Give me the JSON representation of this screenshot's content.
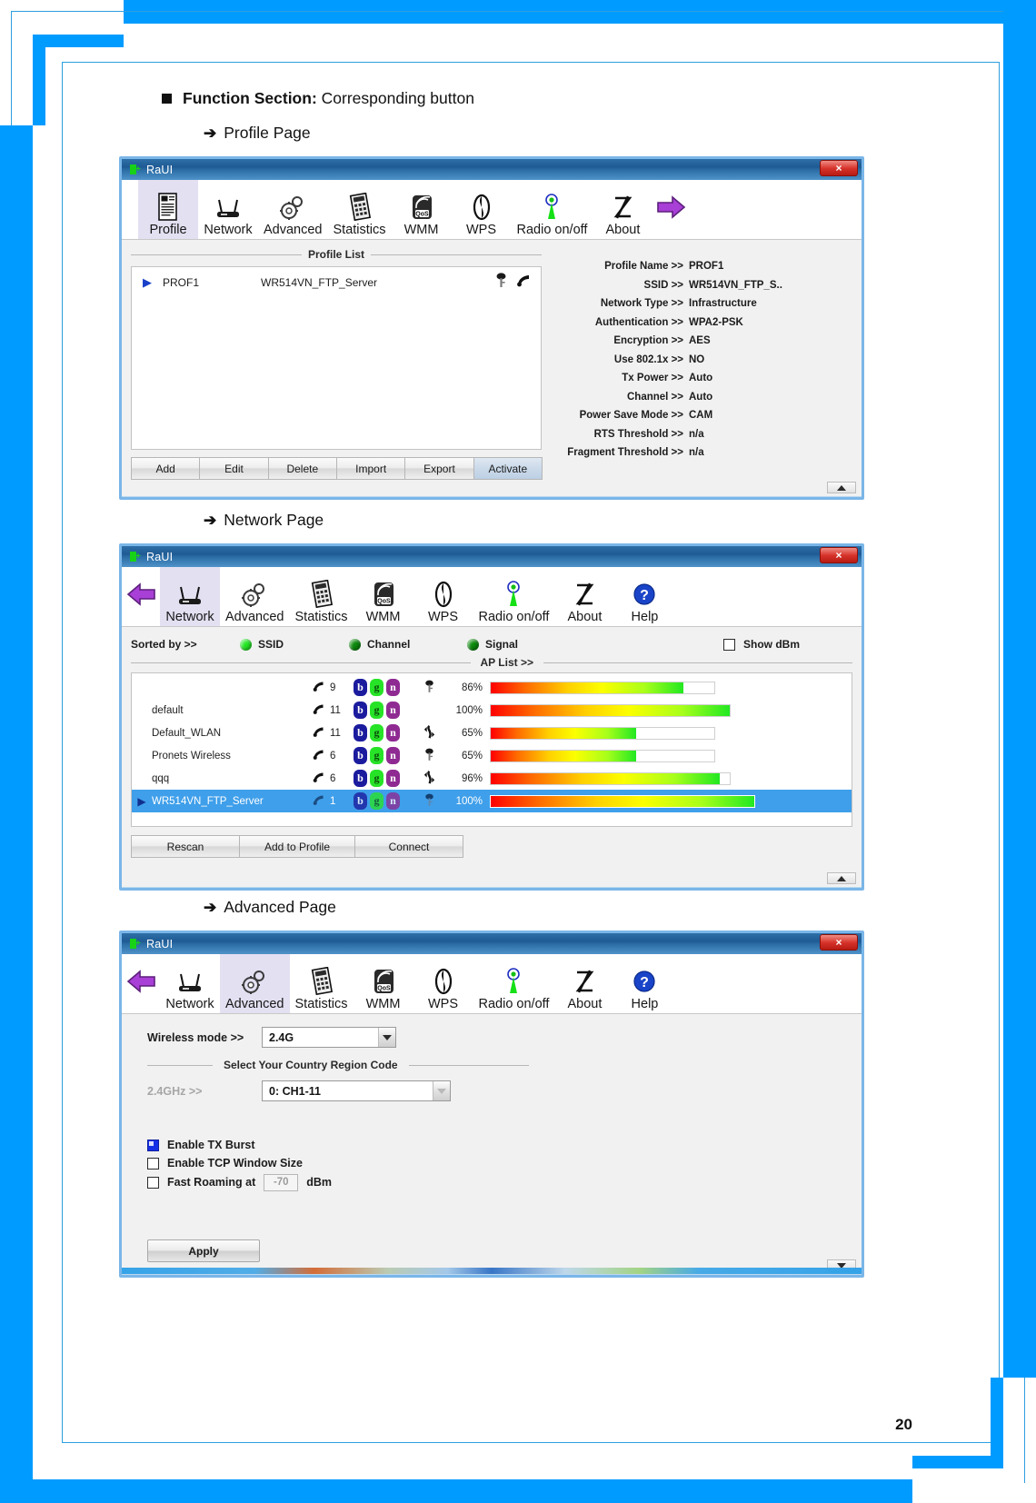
{
  "document": {
    "heading_bold": "Function Section:",
    "heading_rest": "Corresponding button",
    "page_number": "20",
    "sections": [
      {
        "arrow": "➔",
        "label": "Profile Page"
      },
      {
        "arrow": "➔",
        "label": "Network Page"
      },
      {
        "arrow": "➔",
        "label": "Advanced Page"
      }
    ]
  },
  "colors": {
    "page_border": "#009bff",
    "titlebar": "#1f5a94",
    "active_tab": "#e3e0f2",
    "selection": "#3f9fea",
    "led_on": "#25e825",
    "led_off": "#0c8a0c",
    "checkbox_checked": "#1330e6"
  },
  "profile_window": {
    "title": "RaUI",
    "close_label": "×",
    "toolbar": [
      {
        "label": "Profile",
        "icon": "profile-document-icon",
        "active": true
      },
      {
        "label": "Network",
        "icon": "router-icon",
        "active": false
      },
      {
        "label": "Advanced",
        "icon": "gears-icon",
        "active": false
      },
      {
        "label": "Statistics",
        "icon": "calculator-icon",
        "active": false
      },
      {
        "label": "WMM",
        "icon": "qos-signal-icon",
        "active": false
      },
      {
        "label": "WPS",
        "icon": "wps-swirl-icon",
        "active": false
      },
      {
        "label": "Radio on/off",
        "icon": "antenna-icon",
        "active": false
      },
      {
        "label": "About",
        "icon": "about-z-icon",
        "active": false
      }
    ],
    "nav_next_icon": "purple-right-arrow-icon",
    "list_legend": "Profile List",
    "rows": [
      {
        "caret": "▶",
        "name": "PROF1",
        "ssid": "WR514VN_FTP_Server",
        "icons": [
          "key-icon",
          "wifi-signal-icon"
        ]
      }
    ],
    "buttons": [
      {
        "label": "Add",
        "selected": false
      },
      {
        "label": "Edit",
        "selected": false
      },
      {
        "label": "Delete",
        "selected": false
      },
      {
        "label": "Import",
        "selected": false
      },
      {
        "label": "Export",
        "selected": false
      },
      {
        "label": "Activate",
        "selected": true
      }
    ],
    "details": [
      {
        "key": "Profile Name >>",
        "value": "PROF1"
      },
      {
        "key": "SSID >>",
        "value": "WR514VN_FTP_S.."
      },
      {
        "key": "Network Type >>",
        "value": "Infrastructure"
      },
      {
        "key": "Authentication >>",
        "value": "WPA2-PSK"
      },
      {
        "key": "Encryption >>",
        "value": "AES"
      },
      {
        "key": "Use 802.1x >>",
        "value": "NO"
      },
      {
        "key": "Tx Power >>",
        "value": "Auto"
      },
      {
        "key": "Channel >>",
        "value": "Auto"
      },
      {
        "key": "Power Save Mode >>",
        "value": "CAM"
      },
      {
        "key": "RTS Threshold >>",
        "value": "n/a"
      },
      {
        "key": "Fragment Threshold >>",
        "value": "n/a"
      }
    ],
    "scroll_icon": "scroll-up-arrow-icon"
  },
  "network_window": {
    "title": "RaUI",
    "close_label": "×",
    "back_icon": "purple-left-arrow-icon",
    "toolbar": [
      {
        "label": "Network",
        "icon": "router-icon",
        "active": true
      },
      {
        "label": "Advanced",
        "icon": "gears-icon",
        "active": false
      },
      {
        "label": "Statistics",
        "icon": "calculator-icon",
        "active": false
      },
      {
        "label": "WMM",
        "icon": "qos-signal-icon",
        "active": false
      },
      {
        "label": "WPS",
        "icon": "wps-swirl-icon",
        "active": false
      },
      {
        "label": "Radio on/off",
        "icon": "antenna-icon",
        "active": false
      },
      {
        "label": "About",
        "icon": "about-z-icon",
        "active": false
      },
      {
        "label": "Help",
        "icon": "help-question-icon",
        "active": false
      }
    ],
    "sorted_by_label": "Sorted by >>",
    "sort_options": [
      {
        "label": "SSID",
        "selected": true
      },
      {
        "label": "Channel",
        "selected": false
      },
      {
        "label": "Signal",
        "selected": false
      }
    ],
    "show_dbm": {
      "label": "Show dBm",
      "checked": false
    },
    "ap_list_legend": "AP List >>",
    "ap_rows": [
      {
        "ssid": "",
        "channel": "9",
        "modes": [
          "b",
          "g",
          "n"
        ],
        "security": "key-icon",
        "signal": "86%",
        "percent": 86,
        "selected": false
      },
      {
        "ssid": "default",
        "channel": "11",
        "modes": [
          "b",
          "g",
          "n"
        ],
        "security": "",
        "signal": "100%",
        "percent": 100,
        "selected": false
      },
      {
        "ssid": "Default_WLAN",
        "channel": "11",
        "modes": [
          "b",
          "g",
          "n"
        ],
        "security": "wps-icon",
        "signal": "65%",
        "percent": 65,
        "selected": false
      },
      {
        "ssid": "Pronets Wireless",
        "channel": "6",
        "modes": [
          "b",
          "g",
          "n"
        ],
        "security": "key-icon",
        "signal": "65%",
        "percent": 65,
        "selected": false
      },
      {
        "ssid": "qqq",
        "channel": "6",
        "modes": [
          "b",
          "g",
          "n"
        ],
        "security": "wps-icon",
        "signal": "96%",
        "percent": 96,
        "selected": false
      },
      {
        "ssid": "WR514VN_FTP_Server",
        "channel": "1",
        "modes": [
          "b",
          "g",
          "n"
        ],
        "security": "key-icon",
        "signal": "100%",
        "percent": 100,
        "selected": true
      }
    ],
    "buttons": [
      {
        "label": "Rescan"
      },
      {
        "label": "Add to Profile"
      },
      {
        "label": "Connect"
      }
    ],
    "scroll_icon": "scroll-up-arrow-icon"
  },
  "advanced_window": {
    "title": "RaUI",
    "close_label": "×",
    "back_icon": "purple-left-arrow-icon",
    "toolbar": [
      {
        "label": "Network",
        "icon": "router-icon",
        "active": false
      },
      {
        "label": "Advanced",
        "icon": "gears-icon",
        "active": true
      },
      {
        "label": "Statistics",
        "icon": "calculator-icon",
        "active": false
      },
      {
        "label": "WMM",
        "icon": "qos-signal-icon",
        "active": false
      },
      {
        "label": "WPS",
        "icon": "wps-swirl-icon",
        "active": false
      },
      {
        "label": "Radio on/off",
        "icon": "antenna-icon",
        "active": false
      },
      {
        "label": "About",
        "icon": "about-z-icon",
        "active": false
      },
      {
        "label": "Help",
        "icon": "help-question-icon",
        "active": false
      }
    ],
    "wireless_mode": {
      "label": "Wireless mode >>",
      "value": "2.4G"
    },
    "region_legend": "Select Your Country Region Code",
    "region": {
      "label": "2.4GHz >>",
      "value": "0: CH1-11",
      "disabled": true
    },
    "checkboxes": [
      {
        "label": "Enable TX Burst",
        "checked": true
      },
      {
        "label": "Enable TCP Window Size",
        "checked": false
      },
      {
        "label": "Fast Roaming at",
        "checked": false,
        "value": "-70",
        "unit": "dBm"
      }
    ],
    "apply_label": "Apply",
    "scroll_icon": "scroll-down-arrow-icon"
  }
}
